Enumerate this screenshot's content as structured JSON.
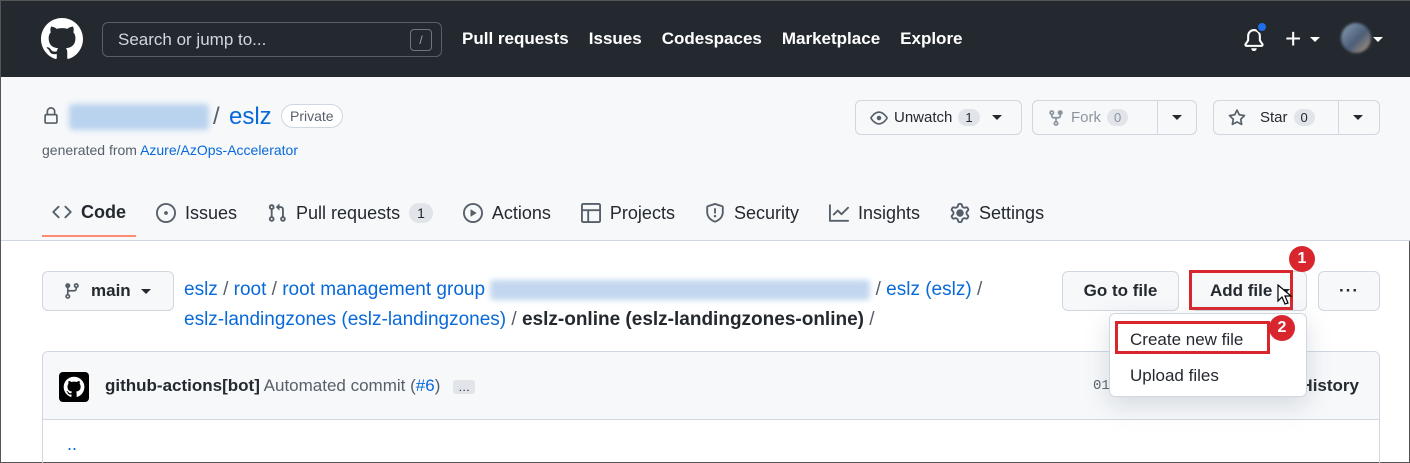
{
  "header": {
    "search_placeholder": "Search or jump to...",
    "search_shortcut": "/",
    "nav": [
      "Pull requests",
      "Issues",
      "Codespaces",
      "Marketplace",
      "Explore"
    ],
    "plus": "+"
  },
  "repo": {
    "separator": "/",
    "name": "eslz",
    "visibility": "Private",
    "generated_prefix": "generated from ",
    "template": "Azure/AzOps-Accelerator",
    "watch_label": "Unwatch",
    "watch_count": "1",
    "fork_label": "Fork",
    "fork_count": "0",
    "star_label": "Star",
    "star_count": "0"
  },
  "tabs": [
    {
      "label": "Code"
    },
    {
      "label": "Issues"
    },
    {
      "label": "Pull requests",
      "count": "1"
    },
    {
      "label": "Actions"
    },
    {
      "label": "Projects"
    },
    {
      "label": "Security"
    },
    {
      "label": "Insights"
    },
    {
      "label": "Settings"
    }
  ],
  "branch": "main",
  "breadcrumb": {
    "root": "eslz",
    "sep": "/",
    "p1": "root",
    "p2": "root management group",
    "p3": "eslz (eslz)",
    "p4": "eslz-landingzones (eslz-landingzones)",
    "current": "eslz-online (eslz-landingzones-online)"
  },
  "actions": {
    "go_to_file": "Go to file",
    "add_file": "Add file",
    "more": "···"
  },
  "dropdown": {
    "create_new_file": "Create new file",
    "upload_files": "Upload files"
  },
  "commit": {
    "author": "github-actions[bot]",
    "message": "Automated commit (",
    "pr": "#6",
    "message_end": ")",
    "ellipsis": "…",
    "sha_partial": "01",
    "history": "History"
  },
  "file_list": {
    "parent_dir": ".."
  },
  "callouts": {
    "first": "1",
    "second": "2"
  },
  "colors": {
    "header_bg": "#24292f",
    "link": "#0969da",
    "callout": "#d9262e",
    "active_tab_underline": "#fd8c73"
  }
}
